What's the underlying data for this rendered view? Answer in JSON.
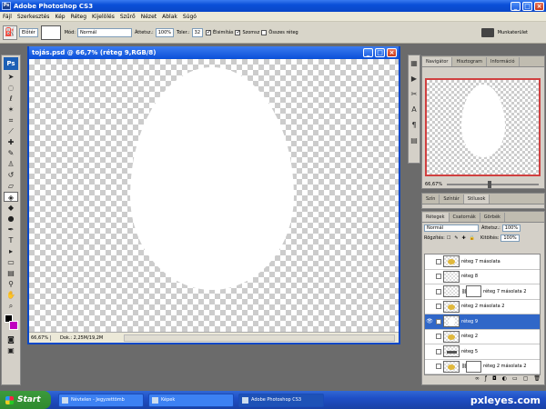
{
  "app": {
    "title": "Adobe Photoshop CS3",
    "badge": "Ps",
    "window_buttons": {
      "minimize": "_",
      "maximize": "□",
      "close": "×"
    }
  },
  "menu": [
    "Fájl",
    "Szerkesztés",
    "Kép",
    "Réteg",
    "Kijelölés",
    "Szűrő",
    "Nézet",
    "Ablak",
    "Súgó"
  ],
  "options": {
    "mode_dropdown": "Előtér",
    "mod_label": "Mód:",
    "mod_value": "Normál",
    "opacity_label": "Áttetsz.:",
    "opacity_value": "100%",
    "tolerance_label": "Toler.:",
    "tolerance_value": "32",
    "cb_antialias": "Élsimítás",
    "cb_contiguous": "Szomsz",
    "cb_all_layers": "Összes réteg",
    "workspace": "Munkaterület"
  },
  "document": {
    "title": "tojás.psd @ 66,7% (réteg 9,RGB/8)",
    "zoom": "66,67%",
    "doc_size": "Dok.: 2,25M/19,2M"
  },
  "navigator": {
    "tabs": [
      "Navigátor",
      "Hisztogram",
      "Információ"
    ],
    "zoom": "66,67%"
  },
  "styles_panel": {
    "tabs": [
      "Szín",
      "Színtár",
      "Stílusok"
    ]
  },
  "layers_panel": {
    "tabs": [
      "Rétegek",
      "Csatornák",
      "Görbék"
    ],
    "blend_mode": "Normál",
    "opacity_label": "Áttetsz.:",
    "opacity_value": "100%",
    "lock_label": "Rögzítés:",
    "fill_label": "Kitöltés:",
    "fill_value": "100%",
    "layers": [
      {
        "name": "réteg 7 másolata",
        "thumb": "gold",
        "mask": false,
        "visible": false,
        "selected": false
      },
      {
        "name": "réteg 8",
        "thumb": "plain",
        "mask": false,
        "visible": false,
        "selected": false
      },
      {
        "name": "réteg 7 másolata 2",
        "thumb": "plain",
        "mask": true,
        "visible": false,
        "selected": false
      },
      {
        "name": "réteg 2 másolata 2",
        "thumb": "gold",
        "mask": false,
        "visible": false,
        "selected": false
      },
      {
        "name": "réteg 9",
        "thumb": "white",
        "mask": false,
        "visible": true,
        "selected": true
      },
      {
        "name": "réteg 2",
        "thumb": "gold",
        "mask": false,
        "visible": false,
        "selected": false
      },
      {
        "name": "réteg 5",
        "thumb": "dark",
        "mask": false,
        "visible": false,
        "selected": false
      },
      {
        "name": "réteg 2 másolata 2",
        "thumb": "gold",
        "mask": true,
        "visible": false,
        "selected": false
      }
    ]
  },
  "taskbar": {
    "start": "Start",
    "items": [
      "Névtelen - Jegyzettömb",
      "Képek",
      "Adobe Photoshop CS3"
    ]
  },
  "watermark": "pxleyes.com",
  "colors": {
    "foreground": "#000000",
    "background": "#c000c0",
    "title_blue": "#0a48c8"
  }
}
